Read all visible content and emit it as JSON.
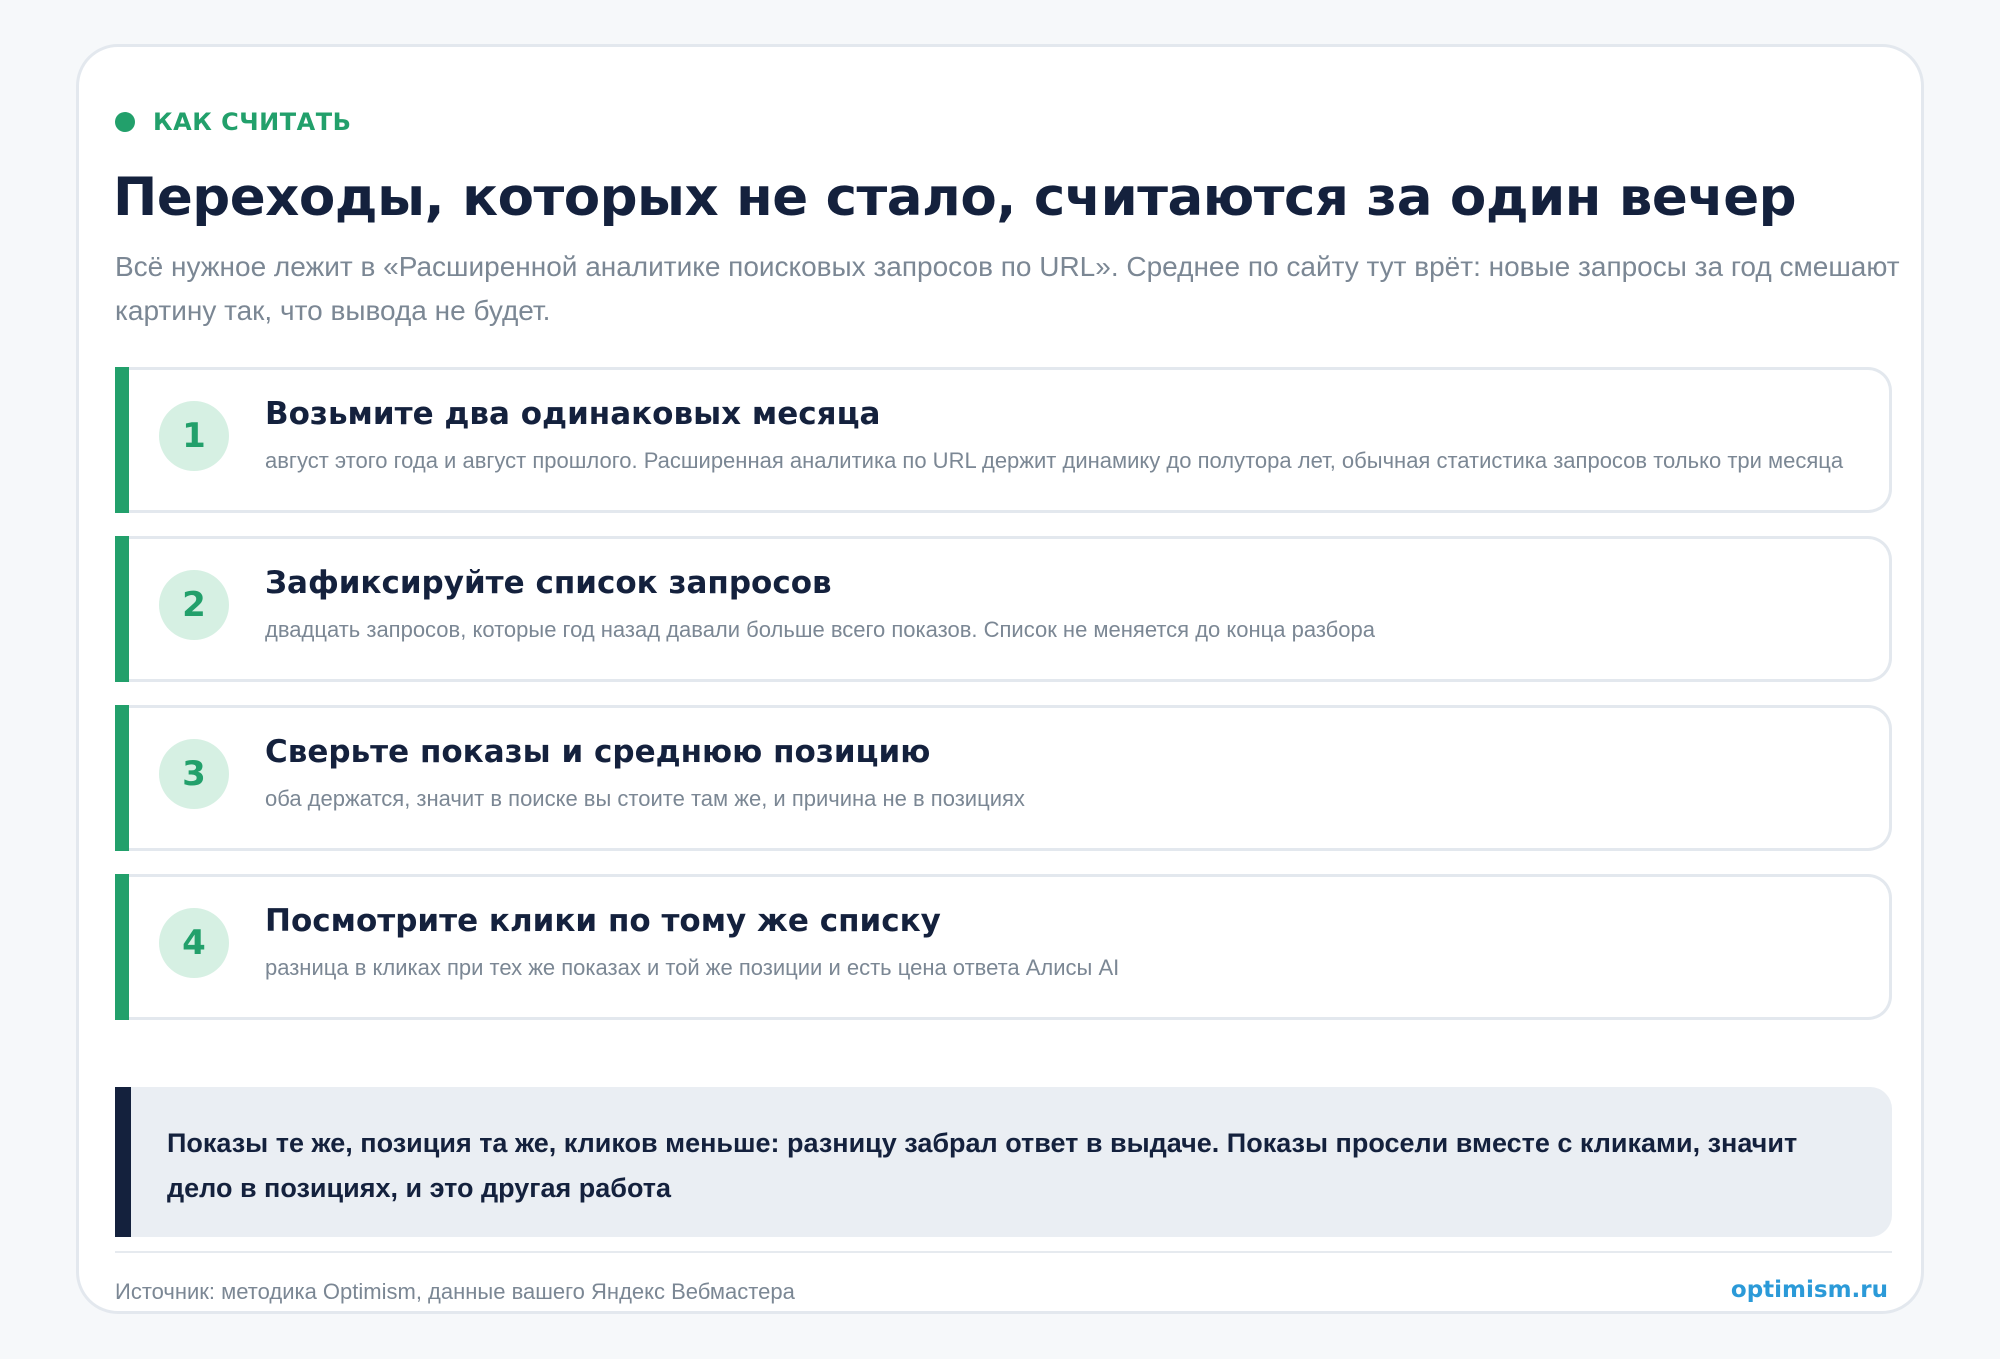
{
  "header": {
    "eyebrow": "КАК СЧИТАТЬ",
    "title": "Переходы, которых не стало, считаются за один вечер",
    "subtitle": "Всё нужное лежит в «Расширенной аналитике поисковых запросов по URL». Среднее по сайту тут врёт: новые запросы за год смешают картину так, что вывода не будет."
  },
  "steps": [
    {
      "number": "1",
      "title": "Возьмите два одинаковых месяца",
      "description": "август этого года и август прошлого. Расширенная аналитика по URL держит динамику до полутора лет, обычная статистика запросов только три месяца"
    },
    {
      "number": "2",
      "title": "Зафиксируйте список запросов",
      "description": "двадцать запросов, которые год назад давали больше всего показов. Список не меняется до конца разбора"
    },
    {
      "number": "3",
      "title": "Сверьте показы и среднюю позицию",
      "description": "оба держатся, значит в поиске вы стоите там же, и причина не в позициях"
    },
    {
      "number": "4",
      "title": "Посмотрите клики по тому же списку",
      "description": "разница в кликах при тех же показах и той же позиции и есть цена ответа Алисы AI"
    }
  ],
  "note": {
    "text": "Показы те же, позиция та же, кликов меньше: разницу забрал ответ в выдаче. Показы просели вместе с кликами, значит дело в позициях, и это другая работа"
  },
  "footer": {
    "source": "Источник: методика Optimism, данные вашего Яндекс Вебмастера",
    "brand": "optimism.ru"
  },
  "colors": {
    "accent": "#22a06b",
    "accent_soft": "#d6f0e3",
    "heading": "#14213d",
    "muted": "#7b8794",
    "link": "#2b9ad8",
    "note_bg": "#eaeef3"
  }
}
